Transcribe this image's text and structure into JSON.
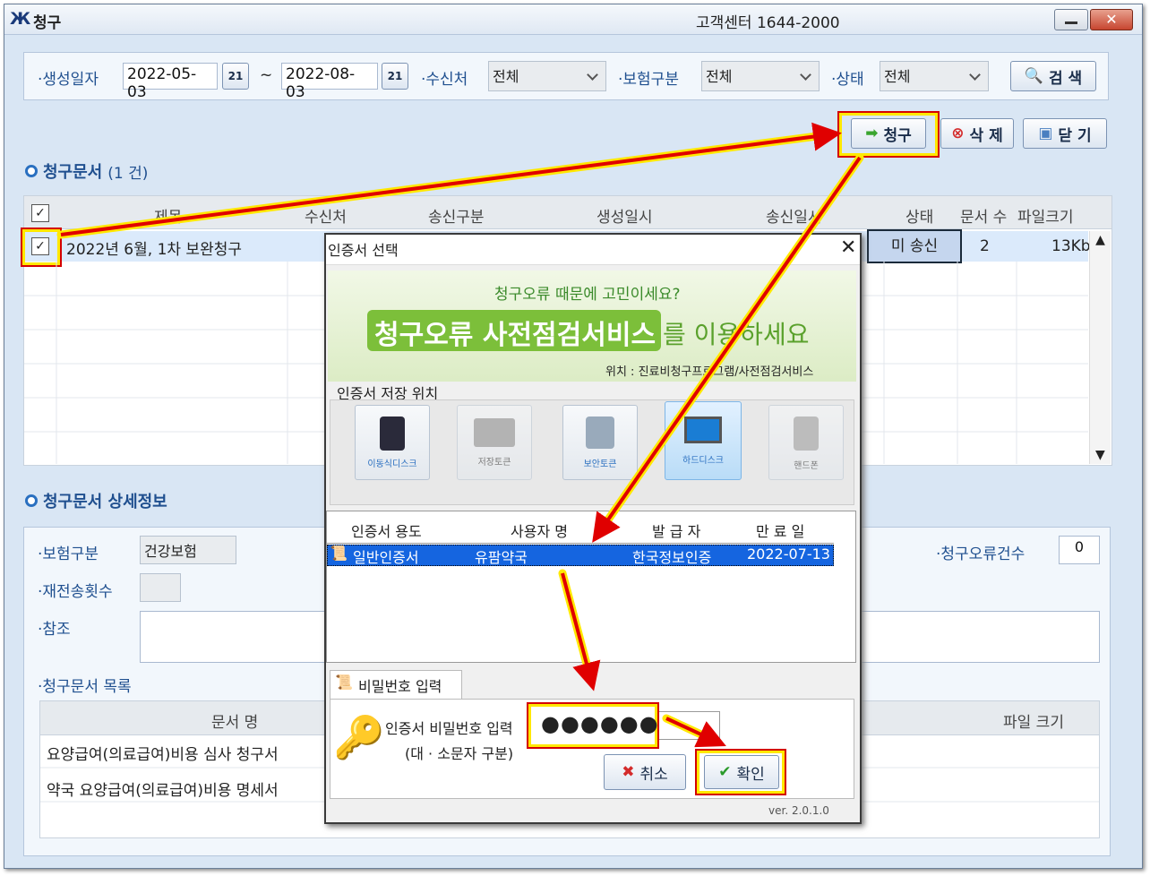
{
  "window": {
    "title": "청구",
    "support": "고객센터 1644-2000",
    "title_icon": "app-logo-icon"
  },
  "search": {
    "date_label": "·생성일자",
    "date_from": "2022-05-03",
    "tilde": "~",
    "date_to": "2022-08-03",
    "receiver_label": "·수신처",
    "receiver_value": "전체",
    "insurance_label": "·보험구분",
    "insurance_value": "전체",
    "status_label": "·상태",
    "status_value": "전체",
    "search_button": "검 색"
  },
  "actions": {
    "claim": "청구",
    "delete": "삭 제",
    "close": "닫 기"
  },
  "claims": {
    "title": "청구문서",
    "count": "(1 건)",
    "columns": [
      "제목",
      "수신처",
      "송신구분",
      "생성일시",
      "송신일시",
      "상태",
      "문서 수",
      "파일크기"
    ],
    "rows": [
      {
        "title": "2022년 6월, 1차 보완청구",
        "status": "미 송신",
        "docs": "2",
        "size": "13Kb"
      }
    ]
  },
  "detail": {
    "title": "청구문서 상세정보",
    "insurance_label": "·보험구분",
    "insurance_value": "건강보험",
    "resend_label": "·재전송횟수",
    "ref_label": "·참조",
    "error_label": "·청구오류건수",
    "error_value": "0",
    "list_label": "·청구문서 목록",
    "list_columns": [
      "문서 명",
      "파일 크기"
    ],
    "list_rows": [
      "요양급여(의료급여)비용 심사 청구서",
      "약국 요양급여(의료급여)비용 명세서"
    ]
  },
  "dialog": {
    "title": "인증서 선택",
    "banner_top": "청구오류 때문에 고민이세요?",
    "banner_main": "청구오류 사전점검서비스",
    "banner_tail": "를 이용하세요",
    "banner_loc": "위치 : 진료비청구프로그램/사전점검서비스",
    "storage_label": "인증서 저장 위치",
    "storage": [
      "이동식디스크",
      "저장토큰",
      "보안토큰",
      "하드디스크",
      "핸드폰"
    ],
    "cert_columns": [
      "인증서 용도",
      "사용자 명",
      "발 급 자",
      "만 료 일"
    ],
    "cert_row": {
      "use": "일반인증서",
      "user": "유팜약국",
      "issuer": "한국정보인증",
      "expiry": "2022-07-13"
    },
    "pw_tab": "비밀번호 입력",
    "pw_label": "인증서 비밀번호 입력",
    "pw_hint": "(대 · 소문자 구분)",
    "pw_value": "●●●●●●",
    "cancel": "취소",
    "ok": "확인",
    "version": "ver. 2.0.1.0"
  },
  "colors": {
    "accent": "#1f4f8f",
    "highlight_red": "#d40000",
    "highlight_yellow": "#ffe800",
    "selected_row": "#1565e0"
  }
}
